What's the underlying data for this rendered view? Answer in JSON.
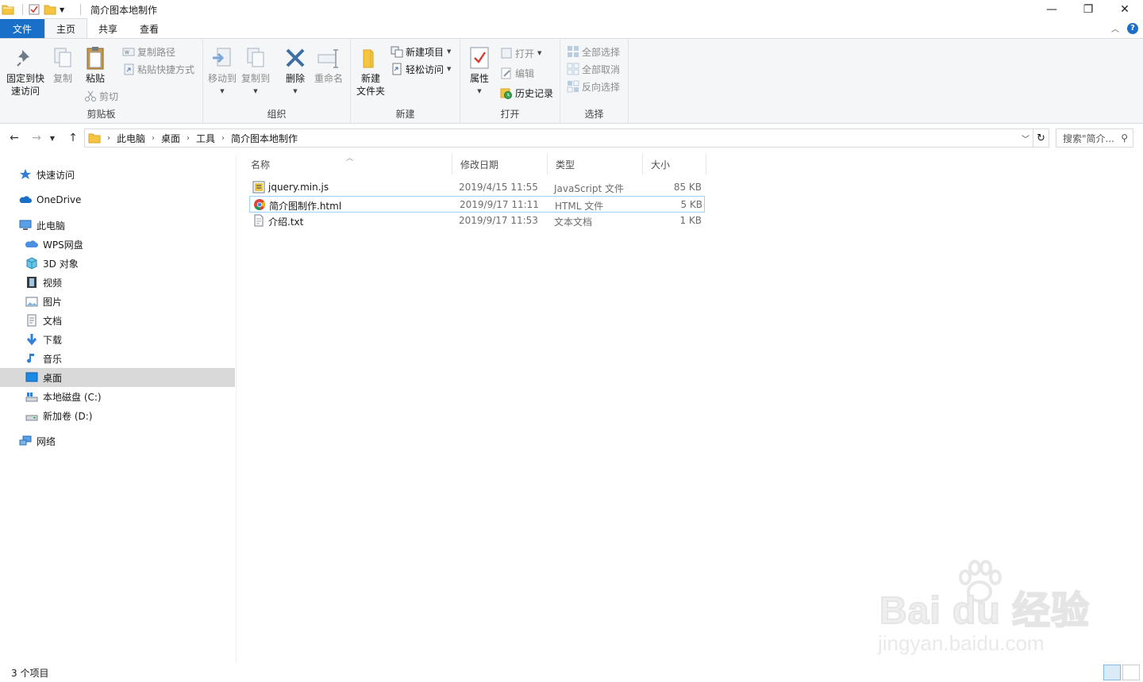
{
  "window": {
    "title": "简介图本地制作",
    "controls": {
      "minimize": "—",
      "maximize": "❐",
      "close": "✕"
    }
  },
  "ribbon_tabs": [
    "文件",
    "主页",
    "共享",
    "查看"
  ],
  "ribbon": {
    "clipboard": {
      "label": "剪贴板",
      "pin": "固定到快\n速访问",
      "pin_l1": "固定到快",
      "pin_l2": "速访问",
      "copy": "复制",
      "paste": "粘贴",
      "copy_path": "复制路径",
      "paste_shortcut": "粘贴快捷方式",
      "cut": "剪切"
    },
    "organize": {
      "label": "组织",
      "move_to": "移动到",
      "copy_to": "复制到",
      "delete": "删除",
      "rename": "重命名"
    },
    "new": {
      "label": "新建",
      "new_folder_l1": "新建",
      "new_folder_l2": "文件夹",
      "new_item": "新建项目",
      "easy_access": "轻松访问"
    },
    "open": {
      "label": "打开",
      "properties": "属性",
      "open": "打开",
      "edit": "编辑",
      "history": "历史记录"
    },
    "select": {
      "label": "选择",
      "select_all": "全部选择",
      "select_none": "全部取消",
      "invert": "反向选择"
    }
  },
  "address": {
    "crumbs": [
      "此电脑",
      "桌面",
      "工具",
      "简介图本地制作"
    ],
    "search_placeholder": "搜索\"简介..."
  },
  "nav_pane": {
    "quick_access": "快速访问",
    "onedrive": "OneDrive",
    "this_pc": "此电脑",
    "wps": "WPS网盘",
    "objects3d": "3D 对象",
    "videos": "视频",
    "pictures": "图片",
    "documents": "文档",
    "downloads": "下载",
    "music": "音乐",
    "desktop": "桌面",
    "local_c": "本地磁盘 (C:)",
    "new_d": "新加卷 (D:)",
    "network": "网络"
  },
  "columns": {
    "name": "名称",
    "date": "修改日期",
    "type": "类型",
    "size": "大小"
  },
  "files": [
    {
      "name": "jquery.min.js",
      "date": "2019/4/15 11:55",
      "type": "JavaScript 文件",
      "size": "85 KB"
    },
    {
      "name": "简介图制作.html",
      "date": "2019/9/17 11:11",
      "type": "HTML 文件",
      "size": "5 KB"
    },
    {
      "name": "介绍.txt",
      "date": "2019/9/17 11:53",
      "type": "文本文档",
      "size": "1 KB"
    }
  ],
  "status": {
    "item_count": "3 个项目"
  },
  "watermark": {
    "brand": "Bai du 经验",
    "url": "jingyan.baidu.com"
  },
  "colors": {
    "accent": "#1a6fc9",
    "selection": "#d9d9d9",
    "row_select_border": "#99d1ff"
  }
}
